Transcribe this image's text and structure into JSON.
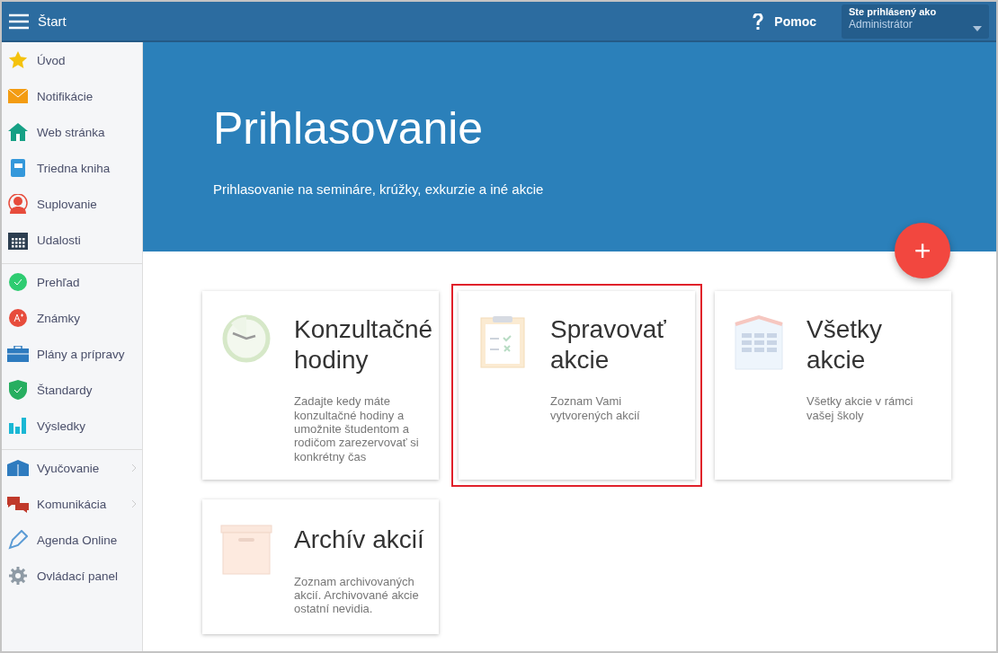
{
  "topbar": {
    "title": "Štart",
    "help": "Pomoc",
    "user_label": "Ste prihlásený ako",
    "user_name": "Administrátor"
  },
  "sidebar": {
    "groups": [
      {
        "items": [
          {
            "label": "Úvod",
            "expandable": false
          },
          {
            "label": "Notifikácie",
            "expandable": false
          },
          {
            "label": "Web stránka",
            "expandable": false
          },
          {
            "label": "Triedna kniha",
            "expandable": false
          },
          {
            "label": "Suplovanie",
            "expandable": false
          },
          {
            "label": "Udalosti",
            "expandable": false
          }
        ]
      },
      {
        "items": [
          {
            "label": "Prehľad",
            "expandable": false
          },
          {
            "label": "Známky",
            "expandable": false
          },
          {
            "label": "Plány a prípravy",
            "expandable": false
          },
          {
            "label": "Štandardy",
            "expandable": false
          },
          {
            "label": "Výsledky",
            "expandable": false
          }
        ]
      },
      {
        "items": [
          {
            "label": "Vyučovanie",
            "expandable": true
          },
          {
            "label": "Komunikácia",
            "expandable": true
          },
          {
            "label": "Agenda Online",
            "expandable": false
          },
          {
            "label": "Ovládací panel",
            "expandable": false
          }
        ]
      }
    ]
  },
  "hero": {
    "title": "Prihlasovanie",
    "subtitle": "Prihlasovanie na semináre, krúžky, exkurzie a iné akcie",
    "add_button": "+"
  },
  "cards": [
    {
      "kind": "clock",
      "title": "Konzultačné hodiny",
      "description": "Zadajte kedy máte konzultačné hodiny a umožnite študentom a rodičom zarezervovať si konkrétny čas",
      "highlighted": false
    },
    {
      "kind": "clipboard",
      "title": "Spravovať akcie",
      "description": "Zoznam Vami vytvorených akcií",
      "highlighted": true
    },
    {
      "kind": "building",
      "title": "Všetky akcie",
      "description": "Všetky akcie v rámci vašej školy",
      "highlighted": false
    },
    {
      "kind": "box",
      "title": "Archív akcií",
      "description": "Zoznam archivovaných akcií. Archivované akcie ostatní nevidia.",
      "highlighted": false
    }
  ]
}
